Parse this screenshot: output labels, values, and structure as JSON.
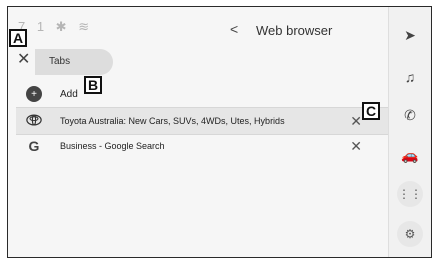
{
  "header": {
    "status_glyphs": "7 1  ✱  ≋",
    "back_chevron": "<",
    "title": "Web browser"
  },
  "tabs": {
    "close": "✕",
    "label": "Tabs"
  },
  "actions": {
    "add_label": "Add"
  },
  "list": [
    {
      "title": "Toyota Australia: New Cars, SUVs, 4WDs, Utes, Hybrids",
      "close": "✕"
    },
    {
      "title": "Business - Google Search",
      "close": "✕"
    }
  ],
  "callouts": {
    "a": "A",
    "b": "B",
    "c": "C"
  },
  "sidebar": {
    "nav_icon": "navigation-arrow-icon",
    "music_icon": "music-note-icon",
    "phone_icon": "phone-icon",
    "car_icon": "car-icon",
    "apps_icon": "apps-grid-icon",
    "settings_icon": "gear-icon"
  }
}
